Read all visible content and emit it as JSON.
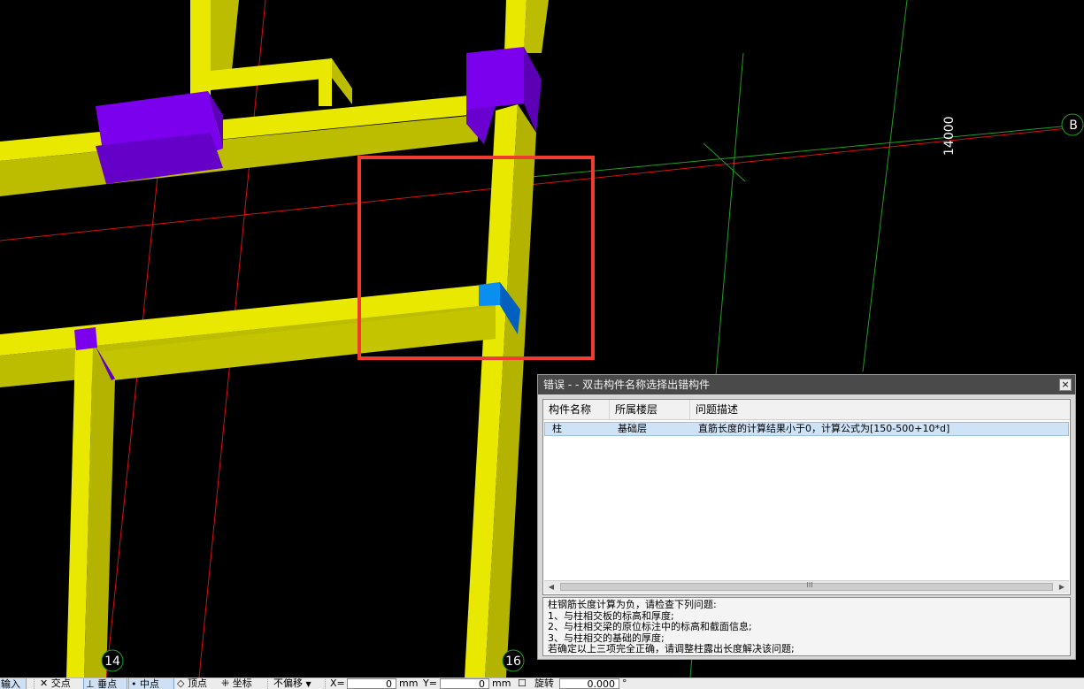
{
  "viewport": {
    "axis_labels": {
      "a14": "14",
      "a16": "16",
      "b": "B"
    },
    "dimension_text": "14000",
    "colors": {
      "background": "#000000",
      "column_face": "#e8e800",
      "column_side": "#b9b900",
      "cap_face": "#7a00ee",
      "highlight_block": "#0090e8",
      "gridline_red": "#e01010",
      "gridline_green": "#22aa22",
      "selection_box": "#f03a30"
    }
  },
  "dialog": {
    "title": "错误 - - 双击构件名称选择出错构件",
    "close_glyph": "×",
    "columns": [
      "构件名称",
      "所属楼层",
      "问题描述"
    ],
    "rows": [
      {
        "name": "柱",
        "floor": "基础层",
        "desc": "直筋长度的计算结果小于0，计算公式为[150-500+10*d]"
      }
    ],
    "scroll_grip": "III",
    "message_lines": [
      "柱钢筋长度计算为负，请检查下列问题:",
      "1、与柱相交板的标高和厚度;",
      "2、与柱相交梁的原位标注中的标高和截面信息;",
      "3、与柱相交的基础的厚度;",
      "若确定以上三项完全正确，请调整柱露出长度解决该问题;"
    ]
  },
  "toolbar": {
    "input_label": "输入",
    "intersection": "交点",
    "perpendicular": "垂点",
    "midpoint": "中点",
    "vertex": "顶点",
    "coordinate": "坐标",
    "offset_mode": "不偏移",
    "x_label": "X=",
    "x_value": "0",
    "x_unit": "mm",
    "y_label": "Y=",
    "y_value": "0",
    "y_unit": "mm",
    "rotate_label": "旋转",
    "rotate_value": "0.000",
    "degree": "°"
  }
}
